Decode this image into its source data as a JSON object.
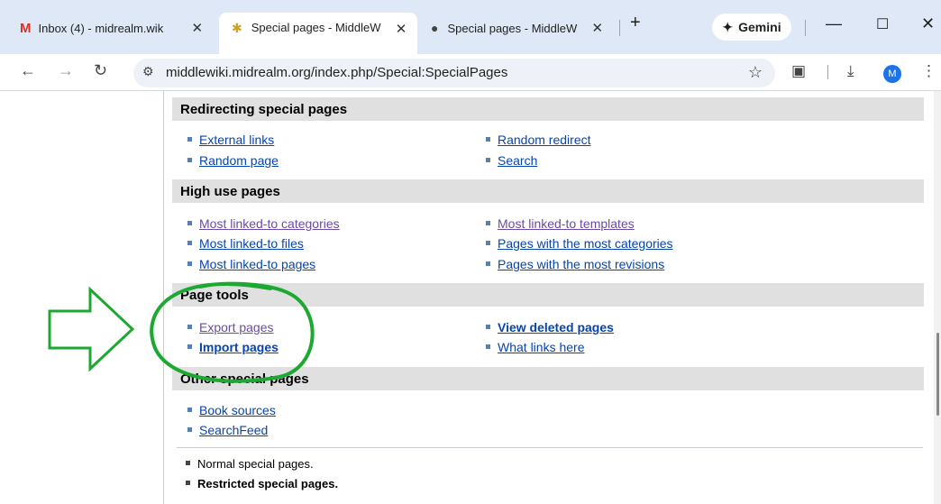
{
  "tabs": [
    {
      "title": "Inbox (4) - midrealm.wik",
      "icon": "gmail-icon"
    },
    {
      "title": "Special pages - MiddleW",
      "icon": "wiki-beetle-icon"
    },
    {
      "title": "Special pages - MiddleW",
      "icon": "globe-icon"
    }
  ],
  "gemini_label": "Gemini",
  "address_url": "middlewiki.midrealm.org/index.php/Special:SpecialPages",
  "avatar_letter": "M",
  "sections": [
    {
      "heading": "Redirecting special pages",
      "left": [
        "External links",
        "Random page"
      ],
      "right": [
        "Random redirect",
        "Search"
      ]
    },
    {
      "heading": "High use pages",
      "left": [
        "Most linked-to categories",
        "Most linked-to files",
        "Most linked-to pages"
      ],
      "right": [
        "Most linked-to templates",
        "Pages with the most categories",
        "Pages with the most revisions"
      ]
    },
    {
      "heading": "Page tools",
      "left": [
        "Export pages",
        "Import pages"
      ],
      "right": [
        "View deleted pages",
        "What links here"
      ]
    },
    {
      "heading": "Other special pages",
      "left": [
        "Book sources",
        "SearchFeed"
      ],
      "right": []
    }
  ],
  "legend": {
    "normal": "Normal special pages.",
    "restricted": "Restricted special pages."
  },
  "colors": {
    "link": "#0645ad",
    "visited_link": "#6b4ba1",
    "annotation": "#1da832",
    "section_bg": "#e0e0e0"
  }
}
